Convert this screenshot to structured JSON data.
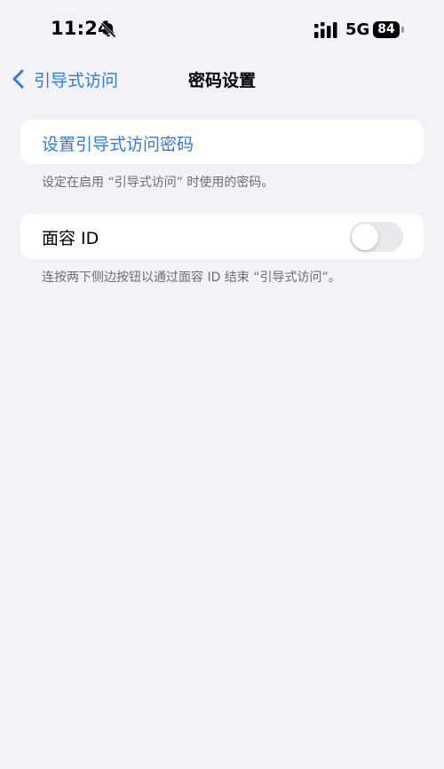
{
  "status_bar": {
    "time": "11:24",
    "network": "5G",
    "battery": "84"
  },
  "nav": {
    "back_label": "引导式访问",
    "title": "密码设置"
  },
  "passcode_group": {
    "set_passcode_label": "设置引导式访问密码",
    "footer": "设定在启用 “引导式访问” 时使用的密码。"
  },
  "faceid_group": {
    "label": "面容 ID",
    "toggle_on": false,
    "footer": "连按两下侧边按钮以通过面容 ID 结束 “引导式访问”。"
  },
  "colors": {
    "accent": "#2f7be0",
    "background": "#f2f2f7",
    "toggle_off": "#e9e9eb"
  }
}
